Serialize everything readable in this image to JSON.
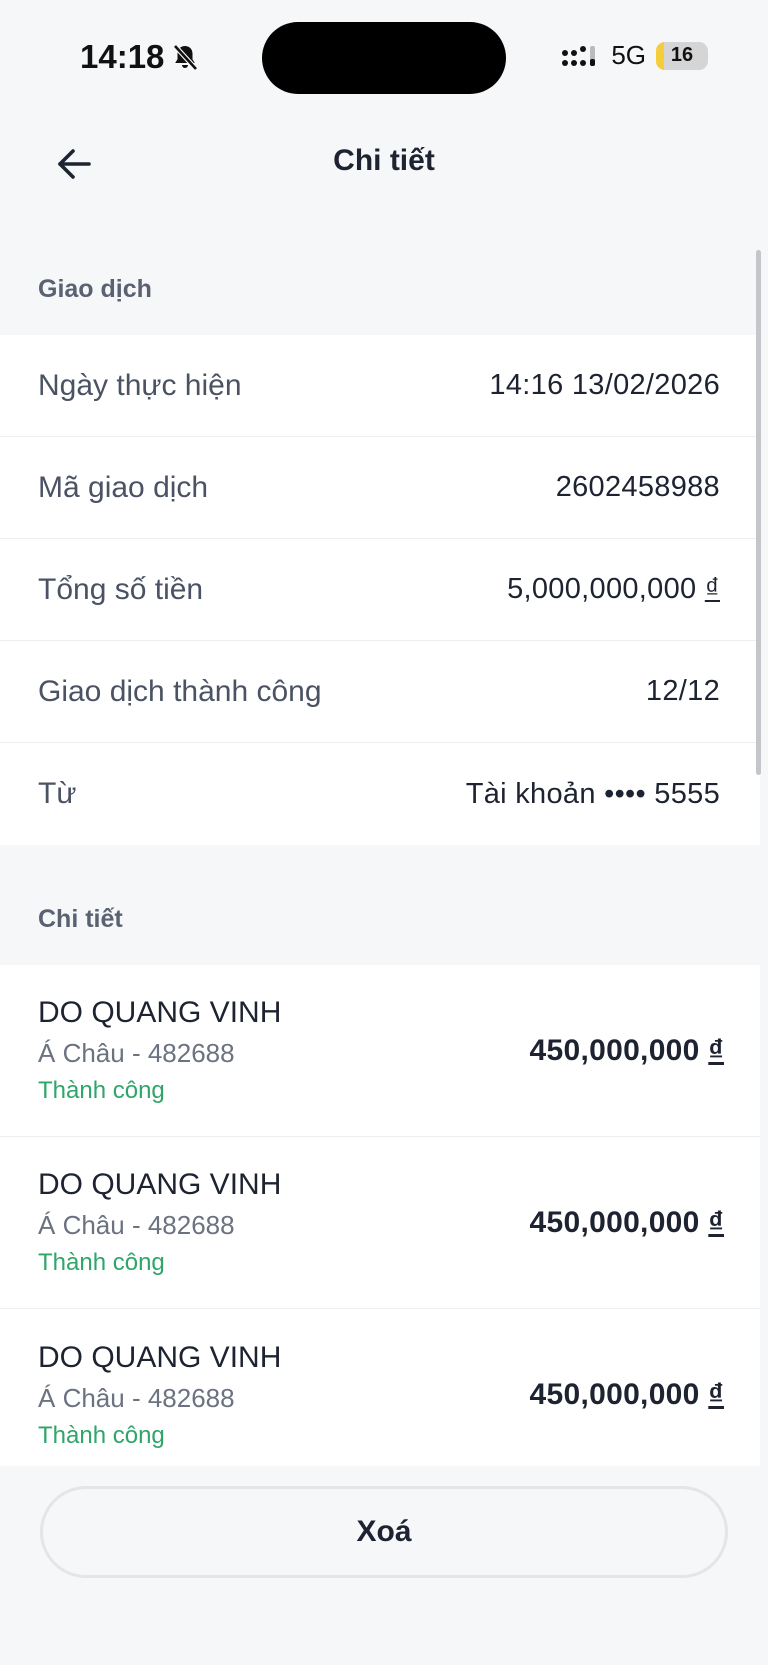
{
  "status_bar": {
    "time": "14:18",
    "network": "5G",
    "battery": "16",
    "battery_level": 0.16
  },
  "header": {
    "title": "Chi tiết"
  },
  "transaction_section": {
    "heading": "Giao dịch",
    "rows": [
      {
        "label": "Ngày thực hiện",
        "value": "14:16 13/02/2026"
      },
      {
        "label": "Mã giao dịch",
        "value": "2602458988"
      },
      {
        "label": "Tổng số tiền",
        "value": "5,000,000,000",
        "currency": "₫"
      },
      {
        "label": "Giao dịch thành công",
        "value": "12/12"
      },
      {
        "label": "Từ",
        "value": "Tài khoản •••• 5555"
      }
    ]
  },
  "detail_section": {
    "heading": "Chi tiết",
    "items": [
      {
        "name": "DO QUANG VINH",
        "bank": "Á Châu - 482688",
        "status": "Thành công",
        "amount": "450,000,000",
        "currency": "₫"
      },
      {
        "name": "DO QUANG VINH",
        "bank": "Á Châu - 482688",
        "status": "Thành công",
        "amount": "450,000,000",
        "currency": "₫"
      },
      {
        "name": "DO QUANG VINH",
        "bank": "Á Châu - 482688",
        "status": "Thành công",
        "amount": "450,000,000",
        "currency": "₫"
      }
    ]
  },
  "footer": {
    "delete_label": "Xoá"
  },
  "colors": {
    "success": "#2fa56a",
    "background": "#f6f7f9",
    "text": "#1d2330"
  }
}
